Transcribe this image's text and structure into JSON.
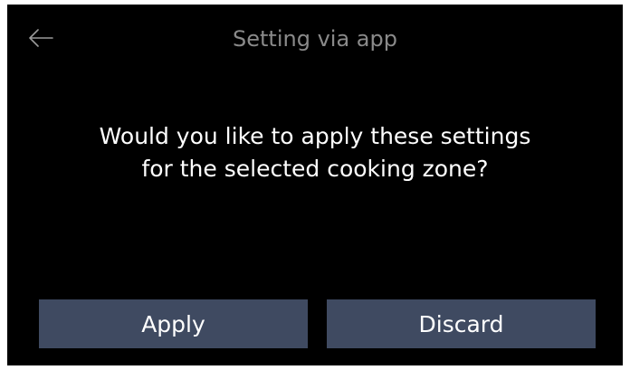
{
  "header": {
    "back_icon": "arrow-left-icon",
    "title": "Setting via app"
  },
  "dialog": {
    "message_line1": "Would you like to apply these settings",
    "message_line2": "for the selected cooking zone?"
  },
  "actions": {
    "apply_label": "Apply",
    "discard_label": "Discard"
  },
  "colors": {
    "background": "#000000",
    "title_text": "#8a8a8a",
    "button_bg": "#3f4a61",
    "text": "#ffffff"
  }
}
